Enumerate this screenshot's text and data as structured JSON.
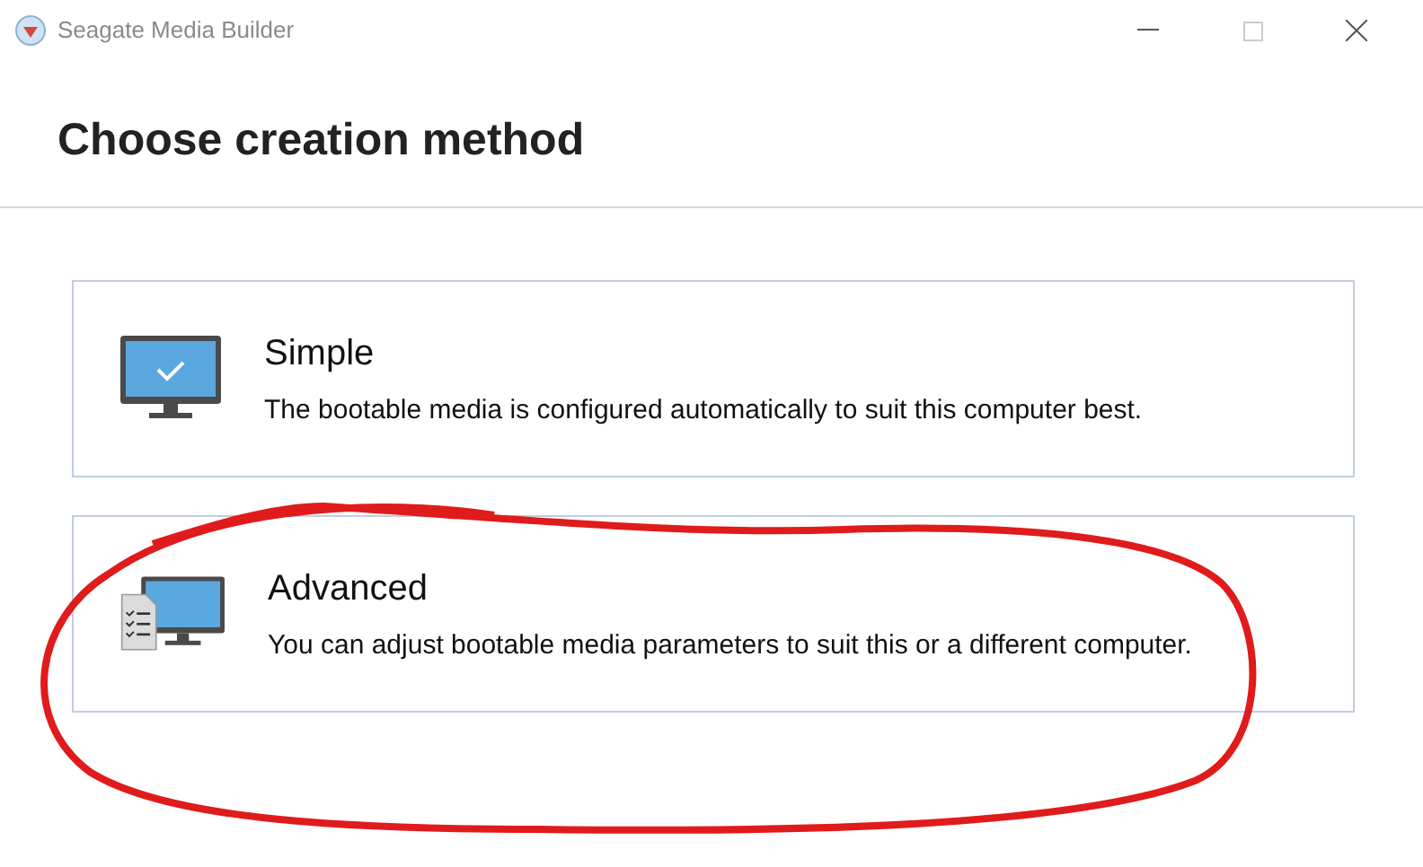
{
  "window": {
    "title": "Seagate Media Builder"
  },
  "heading": "Choose creation method",
  "options": [
    {
      "kind": "simple",
      "title": "Simple",
      "description": "The bootable media is configured automatically to suit this computer best.",
      "circled": false
    },
    {
      "kind": "advanced",
      "title": "Advanced",
      "description": "You can adjust bootable media parameters to suit this or a different computer.",
      "circled": true
    }
  ]
}
